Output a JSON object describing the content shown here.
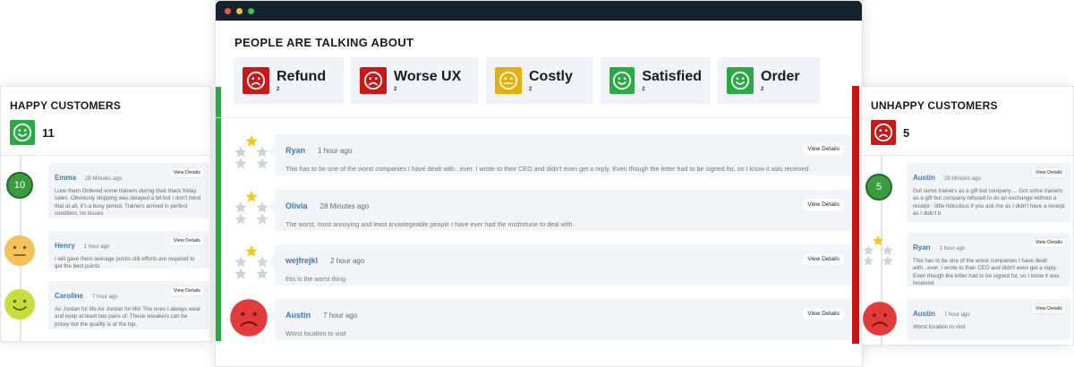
{
  "colors": {
    "positive": "#2aaa45",
    "negative": "#cc1717",
    "neutral": "#e6b00a",
    "accent_name": "#3c79b3",
    "titlebar": "#14232e"
  },
  "window": {
    "controls": [
      "close",
      "minimize",
      "maximize"
    ]
  },
  "topics": {
    "heading": "PEOPLE ARE TALKING ABOUT",
    "items": [
      {
        "label": "Refund",
        "count": "2",
        "sentiment": "negative",
        "icon": "sad-face-icon"
      },
      {
        "label": "Worse UX",
        "count": "2",
        "sentiment": "negative",
        "icon": "sad-face-icon"
      },
      {
        "label": "Costly",
        "count": "2",
        "sentiment": "neutral",
        "icon": "neutral-face-icon"
      },
      {
        "label": "Satisfied",
        "count": "2",
        "sentiment": "positive",
        "icon": "happy-face-icon"
      },
      {
        "label": "Order",
        "count": "2",
        "sentiment": "positive",
        "icon": "happy-face-icon"
      }
    ]
  },
  "happy": {
    "title": "HAPPY CUSTOMERS",
    "count": "11",
    "entries": [
      {
        "indicator": "10",
        "name": "Emma",
        "time": "28 Minutes ago",
        "button": "View Details",
        "text": "Love them Ordered some trainers during their black friday sales. Obviously shipping was delayed a bit but I don't mind that at all, it's a busy period. Trainers arrived in perfect condition, no issues"
      },
      {
        "indicator": "neutral-face-icon",
        "name": "Henry",
        "time": "1 hour ago",
        "button": "View Details",
        "text": "I will gave them average points still efforts are required to get the best points"
      },
      {
        "indicator": "happy-face-icon",
        "name": "Caroline",
        "time": "7 hour ago",
        "button": "View Details",
        "text": "Air Jordan for life Air Jordan for life! The ones I always wear and keep at least two pairs of. These sneakers can be pricey but the quality is at the top."
      }
    ]
  },
  "main_feed": [
    {
      "rating": 1,
      "rating_max": 5,
      "name": "Ryan",
      "time": "1 hour ago",
      "button": "View Details",
      "text": "This has to be one of the worst companies I have dealt with...ever. I wrote to their CEO and didn't even get a reply. Even though the letter had to be signed for, so I know it was received."
    },
    {
      "rating": 1,
      "rating_max": 5,
      "name": "Olivia",
      "time": "28 Minutes ago",
      "button": "View Details",
      "text": "The worst, most annoying and least knowlegeable people I have ever had the misfortune to deal with."
    },
    {
      "rating": 1,
      "rating_max": 5,
      "name": "wejfrejkl",
      "time": "2 hour ago",
      "button": "View Details",
      "text": "this is the worst thing"
    },
    {
      "indicator": "sad-face-icon",
      "name": "Austin",
      "time": "7 hour ago",
      "button": "View Details",
      "text": "Worst location to visit"
    }
  ],
  "unhappy": {
    "title": "UNHAPPY CUSTOMERS",
    "count": "5",
    "entries": [
      {
        "indicator": "5",
        "name": "Austin",
        "time": "28 Minutes ago",
        "button": "View Details",
        "text": "Got some trainers as a gift but company ... Got some trainers as a gift but company refused to do an exchange without a receipt - little ridiculous if you ask me as I didn't have a receipt as I didn't b"
      },
      {
        "rating": 1,
        "rating_max": 5,
        "name": "Ryan",
        "time": "1 hour ago",
        "button": "View Details",
        "text": "This has to be one of the worst companies I have dealt with...ever. I wrote to their CEO and didn't even get a reply. Even though the letter had to be signed for, so I know it was received."
      },
      {
        "indicator": "sad-face-icon",
        "name": "Austin",
        "time": "7 hour ago",
        "button": "View Details",
        "text": "Worst location to visit"
      }
    ]
  }
}
